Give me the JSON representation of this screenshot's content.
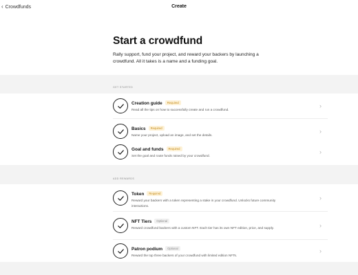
{
  "topbar": {
    "back_label": "Crowdfunds",
    "title": "Create"
  },
  "hero": {
    "title": "Start a crowdfund",
    "description": "Rally support, fund your project, and reward your backers by launching a crowdfund. All it takes is a name and a funding goal."
  },
  "sections": [
    {
      "label": "GET STARTED",
      "items": [
        {
          "title": "Creation guide",
          "badge": "Required",
          "badge_kind": "required",
          "description": "Read all the tips on how to successfully create and run a crowdfund."
        },
        {
          "title": "Basics",
          "badge": "Required",
          "badge_kind": "required",
          "description": "Name your project, upload an image, and set the details."
        },
        {
          "title": "Goal and funds",
          "badge": "Required",
          "badge_kind": "required",
          "description": "Set the goal and route funds raised by your crowdfund."
        }
      ]
    },
    {
      "label": "ADD REWARDS",
      "items": [
        {
          "title": "Token",
          "badge": "Required",
          "badge_kind": "required",
          "description": "Reward your backers with a token representing a stake in your crowdfund. Unlocks future community interactions."
        },
        {
          "title": "NFT Tiers",
          "badge": "Optional",
          "badge_kind": "optional",
          "description": "Reward crowdfund backers with a custom NFT. Each tier has its own NFT edition, price, and supply."
        },
        {
          "title": "Patron podium",
          "badge": "Optional",
          "badge_kind": "optional",
          "description": "Reward the top three backers of your crowdfund with limited edition NFTs."
        }
      ]
    }
  ],
  "colors": {
    "required_badge_bg": "#fdf1d6",
    "required_badge_text": "#c48a18",
    "section_bg": "#f3f3f3"
  },
  "icons": {
    "check": "check-icon",
    "chevron": "chevron-right-icon",
    "back": "chevron-left-icon"
  }
}
